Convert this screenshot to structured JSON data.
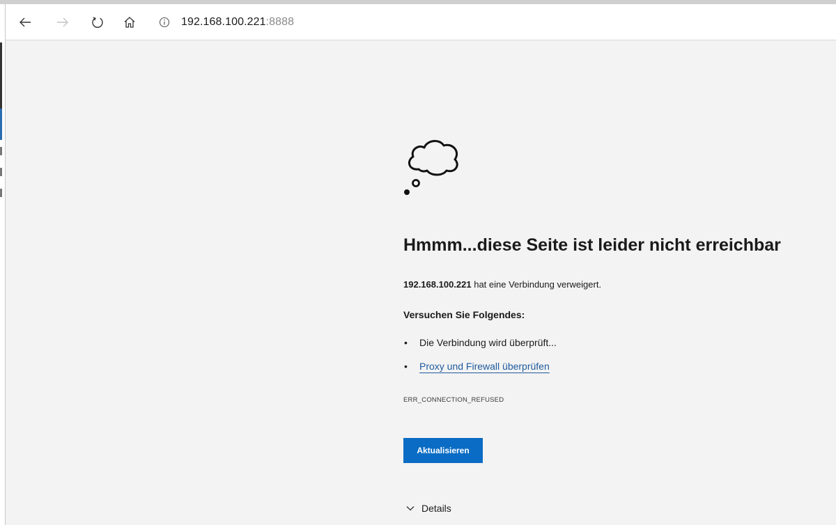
{
  "browser": {
    "url_host": "192.168.100.221",
    "url_port": ":8888",
    "icons": {
      "back": "arrow-left-icon",
      "forward": "arrow-right-icon",
      "refresh": "refresh-icon",
      "home": "home-icon",
      "site_info": "info-icon"
    }
  },
  "error_page": {
    "heading": "Hmmm...diese Seite ist leider nicht erreichbar",
    "host": "192.168.100.221",
    "message_suffix": " hat eine Verbindung verweigert.",
    "suggestions_title": "Versuchen Sie Folgendes:",
    "suggestions": [
      {
        "label": "Die Verbindung wird überprüft..."
      },
      {
        "label": "Proxy und Firewall überprüfen"
      }
    ],
    "error_code": "ERR_CONNECTION_REFUSED",
    "refresh_label": "Aktualisieren",
    "details_label": "Details",
    "bullet": "•"
  },
  "colors": {
    "page_background": "#f3f3f3",
    "accent_button": "#0a6cc4",
    "link": "#1e5a9e"
  }
}
